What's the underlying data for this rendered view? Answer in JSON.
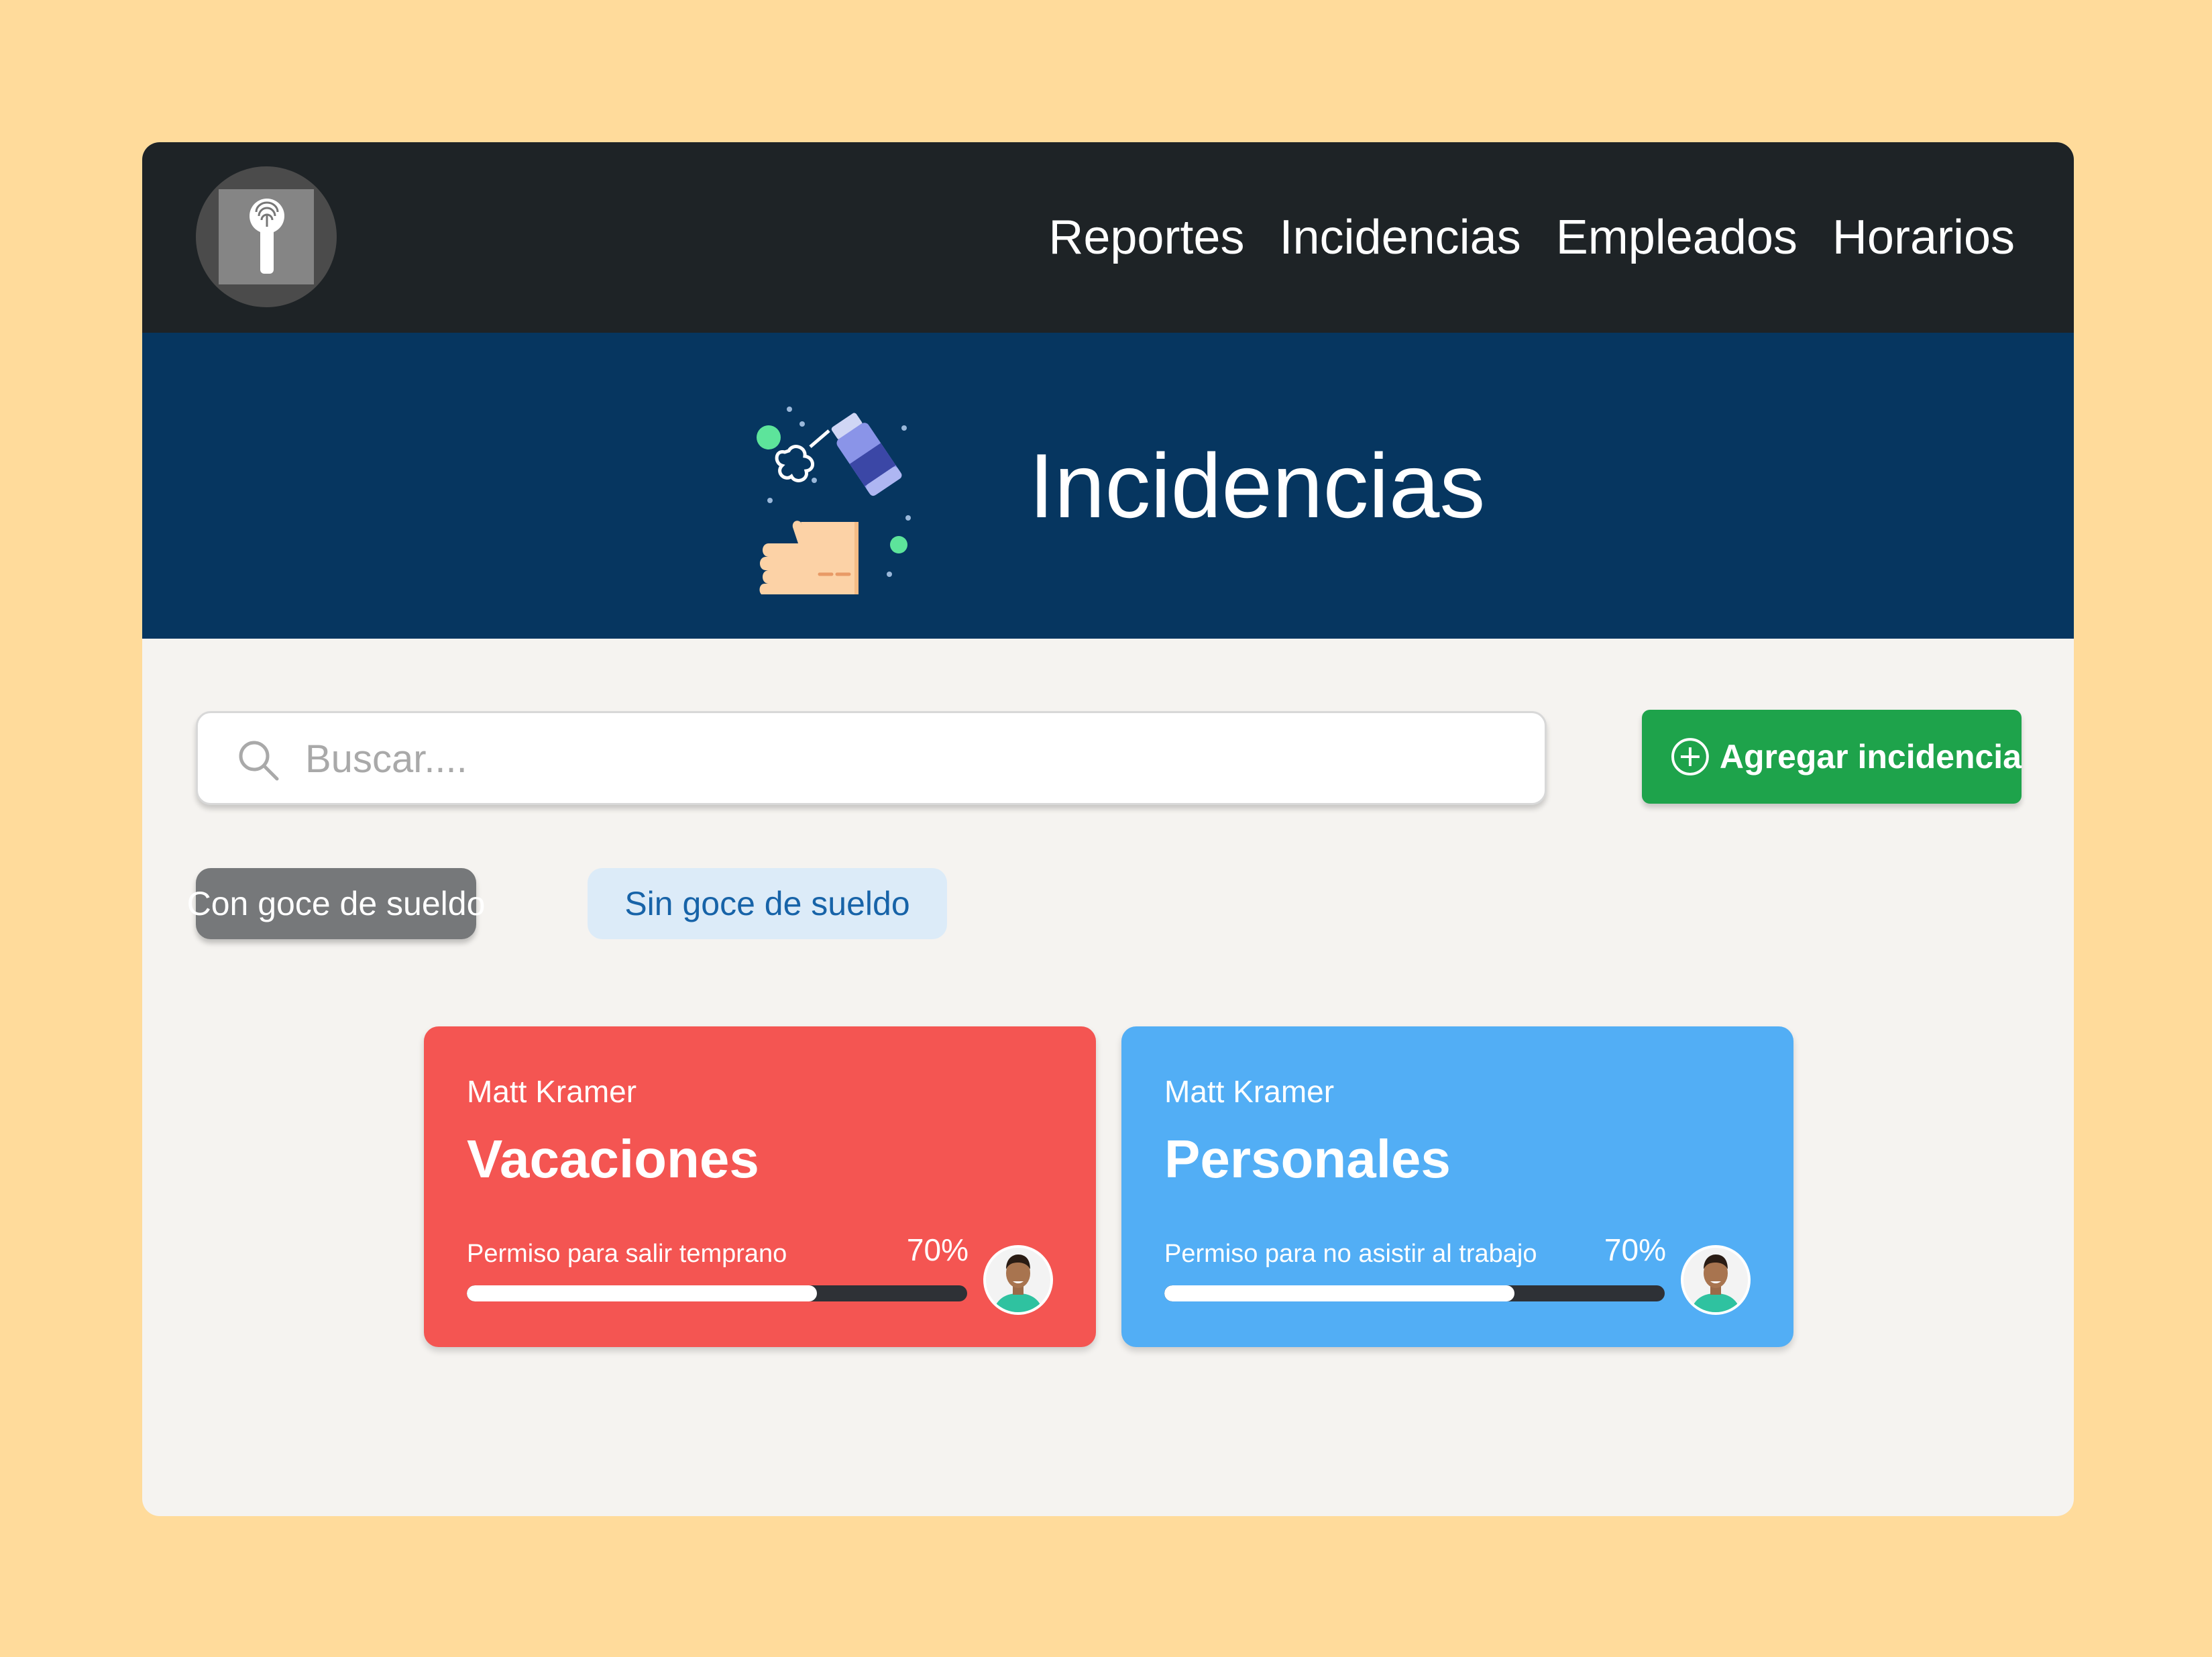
{
  "nav": {
    "items": [
      {
        "label": "Reportes"
      },
      {
        "label": "Incidencias"
      },
      {
        "label": "Empleados"
      },
      {
        "label": "Horarios"
      }
    ]
  },
  "banner": {
    "title": "Incidencias"
  },
  "search": {
    "placeholder": "Buscar...."
  },
  "actions": {
    "add_label": "Agregar incidencia"
  },
  "filters": {
    "con_goce": "Con goce de sueldo",
    "sin_goce": "Sin goce de sueldo"
  },
  "cards": [
    {
      "employee": "Matt Kramer",
      "type": "Vacaciones",
      "description": "Permiso para salir temprano",
      "percent_label": "70%",
      "progress": 0.7,
      "color": "#F45552"
    },
    {
      "employee": "Matt Kramer",
      "type": "Personales",
      "description": "Permiso para no asistir al trabajo",
      "percent_label": "70%",
      "progress": 0.7,
      "color": "#52AEF5"
    }
  ],
  "colors": {
    "background": "#FFDB9B",
    "topbar": "#1E2326",
    "banner": "#063660",
    "accent_green": "#1EA34B"
  },
  "icons": {
    "logo": "fingerprint-logo-icon",
    "banner": "hand-sanitizer-icon",
    "search": "search-icon",
    "add": "plus-circle-icon",
    "avatar": "employee-avatar"
  }
}
